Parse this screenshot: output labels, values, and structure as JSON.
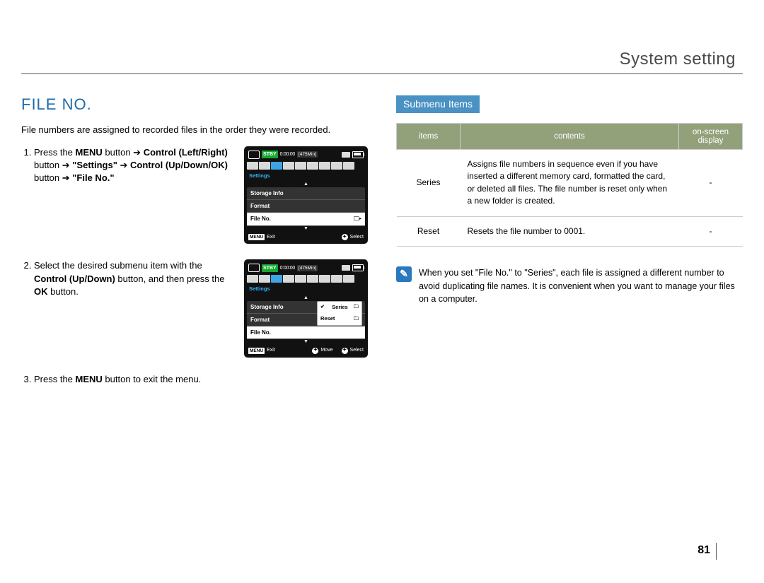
{
  "header": {
    "title": "System setting"
  },
  "page_number": "81",
  "section": {
    "title": "FILE NO.",
    "intro": "File numbers are assigned to recorded files in the order they were recorded.",
    "steps": {
      "s1_a": "Press the ",
      "s1_menu": "MENU",
      "s1_b": " button ➔ ",
      "s1_ctrl_lr": "Control (Left/Right)",
      "s1_c": " button ➔ ",
      "s1_settings": "\"Settings\"",
      "s1_d": " ➔ ",
      "s1_ctrl_ud": "Control (Up/Down/OK)",
      "s1_e": " button ➔ ",
      "s1_fileno": "\"File No.\"",
      "s2_a": "Select the desired submenu item with the ",
      "s2_ctrl": "Control (Up/Down)",
      "s2_b": " button, and then press the ",
      "s2_ok": "OK",
      "s2_c": " button.",
      "s3_a": "Press the ",
      "s3_menu": "MENU",
      "s3_b": " button to exit the menu."
    }
  },
  "lcd": {
    "stby": "STBY",
    "timecode": "0:00:00",
    "remain": "[475Min]",
    "label": "Settings",
    "items": {
      "storage": "Storage Info",
      "format": "Format",
      "fileno": "File No."
    },
    "flyout": {
      "series": "Series",
      "reset": "Reset"
    },
    "bottom": {
      "menu": "MENU",
      "exit": "Exit",
      "move": "Move",
      "select": "Select"
    }
  },
  "right": {
    "submenu_title": "Submenu Items",
    "table": {
      "head": {
        "items": "items",
        "contents": "contents",
        "osd": "on-screen display"
      },
      "rows": [
        {
          "name": "Series",
          "content": "Assigns file numbers in sequence even if you have inserted a different memory card, formatted the card, or deleted all files. The file number is reset only when a new folder is created.",
          "osd": "-"
        },
        {
          "name": "Reset",
          "content": "Resets the file number to 0001.",
          "osd": "-"
        }
      ]
    },
    "note": "When you set \"File No.\" to \"Series\", each file is assigned a different number to avoid duplicating file names. It is convenient when you want to manage your files on a computer."
  }
}
